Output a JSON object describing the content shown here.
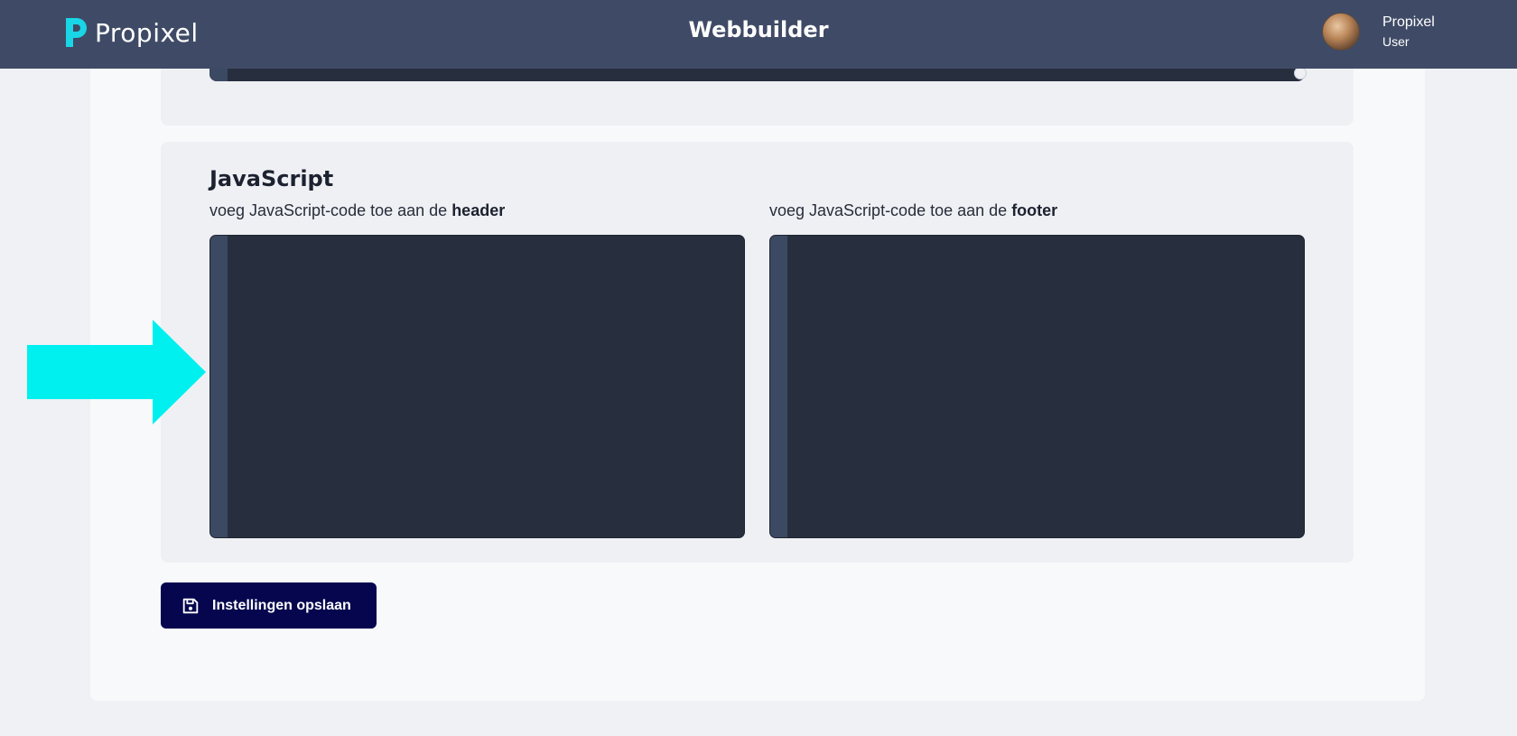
{
  "header": {
    "logo_text": "Propixel",
    "app_title": "Webbuilder",
    "user": {
      "name": "Propixel",
      "role": "User"
    }
  },
  "javascript_section": {
    "title": "JavaScript",
    "header_label_prefix": "voeg JavaScript-code toe aan de",
    "header_label_bold": "header",
    "footer_label_prefix": "voeg JavaScript-code toe aan de",
    "footer_label_bold": "footer",
    "header_code": "",
    "footer_code": ""
  },
  "actions": {
    "save_label": "Instellingen opslaan"
  },
  "colors": {
    "topbar": "#3f4b66",
    "brand_accent": "#18d6e6",
    "editor_bg": "#272f3e",
    "editor_gutter": "#3c4963",
    "primary_button": "#05064e",
    "annotation_arrow": "#00f0f0"
  },
  "icons": {
    "logo": "propixel-logo-icon",
    "save": "save-icon",
    "annotation": "arrow-right-icon"
  }
}
